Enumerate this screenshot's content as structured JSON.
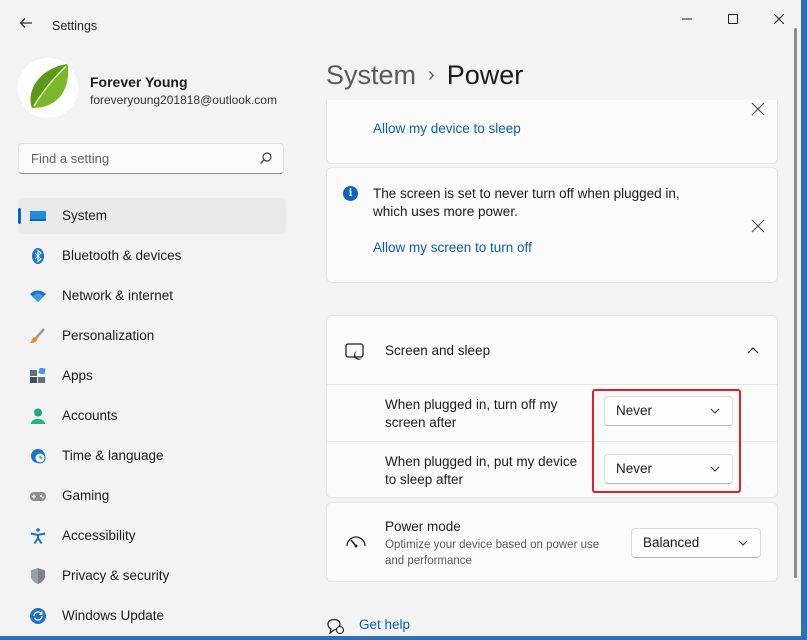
{
  "window": {
    "title": "Settings",
    "controls": {
      "minimize": "—",
      "maximize": "☐",
      "close": "✕"
    }
  },
  "profile": {
    "name": "Forever Young",
    "email": "foreveryoung201818@outlook.com"
  },
  "search": {
    "placeholder": "Find a setting"
  },
  "nav": {
    "items": [
      {
        "label": "System",
        "icon": "monitor-icon",
        "active": true
      },
      {
        "label": "Bluetooth & devices",
        "icon": "bluetooth-icon"
      },
      {
        "label": "Network & internet",
        "icon": "wifi-icon"
      },
      {
        "label": "Personalization",
        "icon": "brush-icon"
      },
      {
        "label": "Apps",
        "icon": "apps-icon"
      },
      {
        "label": "Accounts",
        "icon": "person-icon"
      },
      {
        "label": "Time & language",
        "icon": "globe-clock-icon"
      },
      {
        "label": "Gaming",
        "icon": "gamepad-icon"
      },
      {
        "label": "Accessibility",
        "icon": "accessibility-icon"
      },
      {
        "label": "Privacy & security",
        "icon": "shield-icon"
      },
      {
        "label": "Windows Update",
        "icon": "update-icon"
      }
    ]
  },
  "header": {
    "parent": "System",
    "separator": "›",
    "current": "Power"
  },
  "notices": {
    "sleep": {
      "link": "Allow my device to sleep"
    },
    "screen": {
      "text": "The screen is set to never turn off when plugged in, which uses more power.",
      "link": "Allow my screen to turn off"
    }
  },
  "screen_sleep": {
    "title": "Screen and sleep",
    "rows": [
      {
        "label": "When plugged in, turn off my screen after",
        "value": "Never"
      },
      {
        "label": "When plugged in, put my device to sleep after",
        "value": "Never"
      }
    ]
  },
  "power_mode": {
    "title": "Power mode",
    "description": "Optimize your device based on power use and performance",
    "value": "Balanced"
  },
  "help": {
    "label": "Get help"
  },
  "colors": {
    "accent": "#0a64c2",
    "highlight": "#e0202a",
    "link": "#0a5fb4"
  }
}
